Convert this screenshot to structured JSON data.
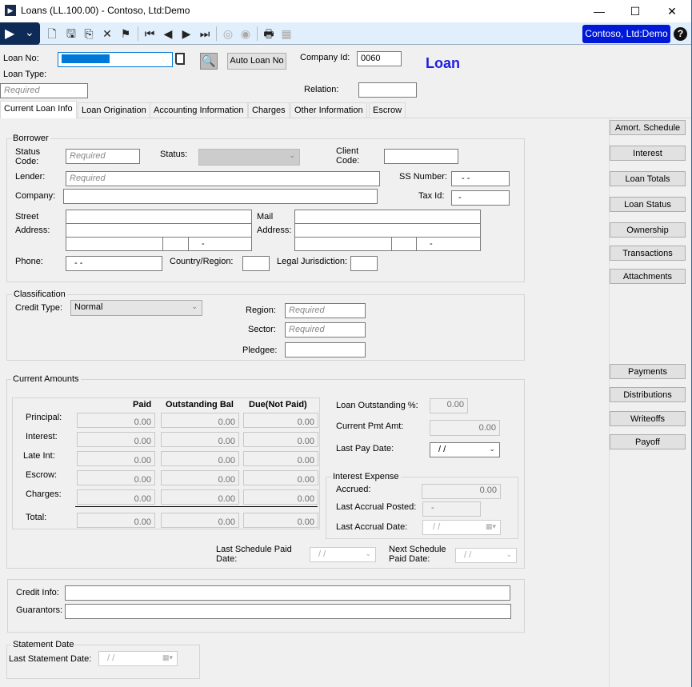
{
  "window": {
    "title": "Loans (LL.100.00) - Contoso, Ltd:Demo",
    "minimize": "—",
    "maximize": "☐",
    "close": "✕"
  },
  "toolbar": {
    "company": "Contoso, Ltd:Demo",
    "help": "?",
    "logo_chevron": "⌄",
    "icons": {
      "new": "🗋",
      "save": "🖫",
      "copy": "⎘",
      "delete": "✕",
      "finish": "⚑",
      "first": "⏮",
      "prev": "◀",
      "next": "▶",
      "last": "⏭",
      "capture": "◎",
      "view": "◉",
      "print": "🖶",
      "excel": "▦"
    }
  },
  "header": {
    "loan_no_label": "Loan No:",
    "loan_type_label": "Loan Type:",
    "loan_type_placeholder": "Required",
    "auto_loan_no": "Auto Loan No",
    "company_id_label": "Company Id:",
    "company_id_value": "0060",
    "relation_label": "Relation:",
    "form_title": "Loan"
  },
  "tabs": [
    "Current Loan Info",
    "Loan Origination",
    "Accounting Information",
    "Charges",
    "Other Information",
    "Escrow"
  ],
  "borrower": {
    "legend": "Borrower",
    "status_code_label": "Status\nCode:",
    "status_code_ph": "Required",
    "status_label": "Status:",
    "client_code_label": "Client\nCode:",
    "lender_label": "Lender:",
    "lender_ph": "Required",
    "ss_label": "SS Number:",
    "ss_value": "- -",
    "company_label": "Company:",
    "tax_label": "Tax Id:",
    "tax_value": "-",
    "street_label": "Street\nAddress:",
    "mail_label": "Mail\nAddress:",
    "zip_dash": "-",
    "phone_label": "Phone:",
    "phone_value": "- -",
    "country_label": "Country/Region:",
    "legal_label": "Legal Jurisdiction:"
  },
  "classification": {
    "legend": "Classification",
    "credit_type_label": "Credit Type:",
    "credit_type_value": "Normal",
    "region_label": "Region:",
    "region_ph": "Required",
    "sector_label": "Sector:",
    "sector_ph": "Required",
    "pledgee_label": "Pledgee:"
  },
  "amounts": {
    "legend": "Current Amounts",
    "columns": [
      "Paid",
      "Outstanding Bal",
      "Due(Not Paid)"
    ],
    "rows": [
      {
        "label": "Principal:",
        "values": [
          "0.00",
          "0.00",
          "0.00"
        ]
      },
      {
        "label": "Interest:",
        "values": [
          "0.00",
          "0.00",
          "0.00"
        ]
      },
      {
        "label": "Late Int:",
        "values": [
          "0.00",
          "0.00",
          "0.00"
        ]
      },
      {
        "label": "Escrow:",
        "values": [
          "0.00",
          "0.00",
          "0.00"
        ]
      },
      {
        "label": "Charges:",
        "values": [
          "0.00",
          "0.00",
          "0.00"
        ]
      },
      {
        "label": "Total:",
        "values": [
          "0.00",
          "0.00",
          "0.00"
        ]
      }
    ],
    "loan_outstanding_label": "Loan Outstanding %:",
    "loan_outstanding_value": "0.00",
    "current_pmt_label": "Current Pmt Amt:",
    "current_pmt_value": "0.00",
    "last_pay_label": "Last Pay Date:",
    "last_pay_value": "/ /",
    "interest_expense": {
      "legend": "Interest Expense",
      "accrued_label": "Accrued:",
      "accrued_value": "0.00",
      "last_posted_label": "Last Accrual Posted:",
      "last_posted_value": "-",
      "last_date_label": "Last Accrual Date:",
      "last_date_value": "/ /"
    },
    "last_sched_label": "Last Schedule Paid\nDate:",
    "last_sched_value": "/ /",
    "next_sched_label": "Next Schedule\nPaid Date:",
    "next_sched_value": "/ /"
  },
  "credit": {
    "credit_info_label": "Credit Info:",
    "guarantors_label": "Guarantors:"
  },
  "statement": {
    "legend": "Statement Date",
    "last_label": "Last Statement Date:",
    "last_value": "/ /"
  },
  "side_buttons": [
    "Amort. Schedule",
    "Interest",
    "Loan Totals",
    "Loan Status",
    "Ownership",
    "Transactions",
    "Attachments"
  ],
  "side_buttons2": [
    "Payments",
    "Distributions",
    "Writeoffs",
    "Payoff"
  ]
}
